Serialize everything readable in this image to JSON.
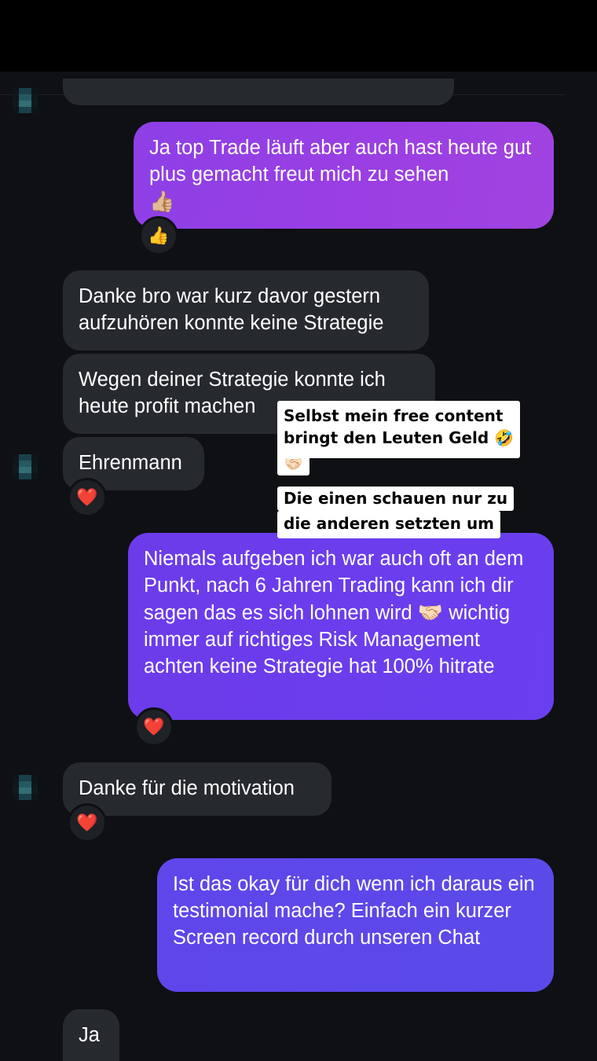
{
  "messages": {
    "m1": {
      "text": "Ja top Trade läuft aber auch hast heute gut plus gemacht freut mich zu sehen",
      "emoji": "👍🏼",
      "reaction": "👍"
    },
    "m2": {
      "text": "Danke bro war kurz davor gestern aufzuhören konnte keine Strategie"
    },
    "m3": {
      "text": "Wegen deiner Strategie konnte ich heute profit machen"
    },
    "m4": {
      "text": "Ehrenmann",
      "reaction": "❤️"
    },
    "m5": {
      "text_before": "Niemals aufgeben ich war auch oft an dem Punkt, nach 6 Jahren Trading kann ich dir sagen das es sich lohnen wird",
      "emoji": "🤝🏻",
      "text_after": "wichtig immer auf richtiges Risk Management achten keine Strategie hat 100% hitrate",
      "reaction": "❤️"
    },
    "m6": {
      "text": "Danke für die motivation",
      "reaction": "❤️"
    },
    "m7": {
      "text": "Ist das okay für dich wenn ich daraus ein testimonial mache? Einfach ein kurzer Screen record durch unseren Chat"
    },
    "m8": {
      "text": "Ja"
    }
  },
  "overlays": {
    "o1": {
      "line1": "Selbst mein free content",
      "line2": "bringt den Leuten Geld 🤣",
      "line3": "🤝🏻"
    },
    "o2": {
      "line1": "Die einen schauen nur zu",
      "line2": "die anderen setzten um"
    }
  },
  "colors": {
    "background": "#0e1014",
    "incoming_bubble": "#26292e",
    "outgoing_purple": "#9b3fe3",
    "outgoing_violet": "#6a3fef",
    "outgoing_blue": "#5a4ae9"
  }
}
